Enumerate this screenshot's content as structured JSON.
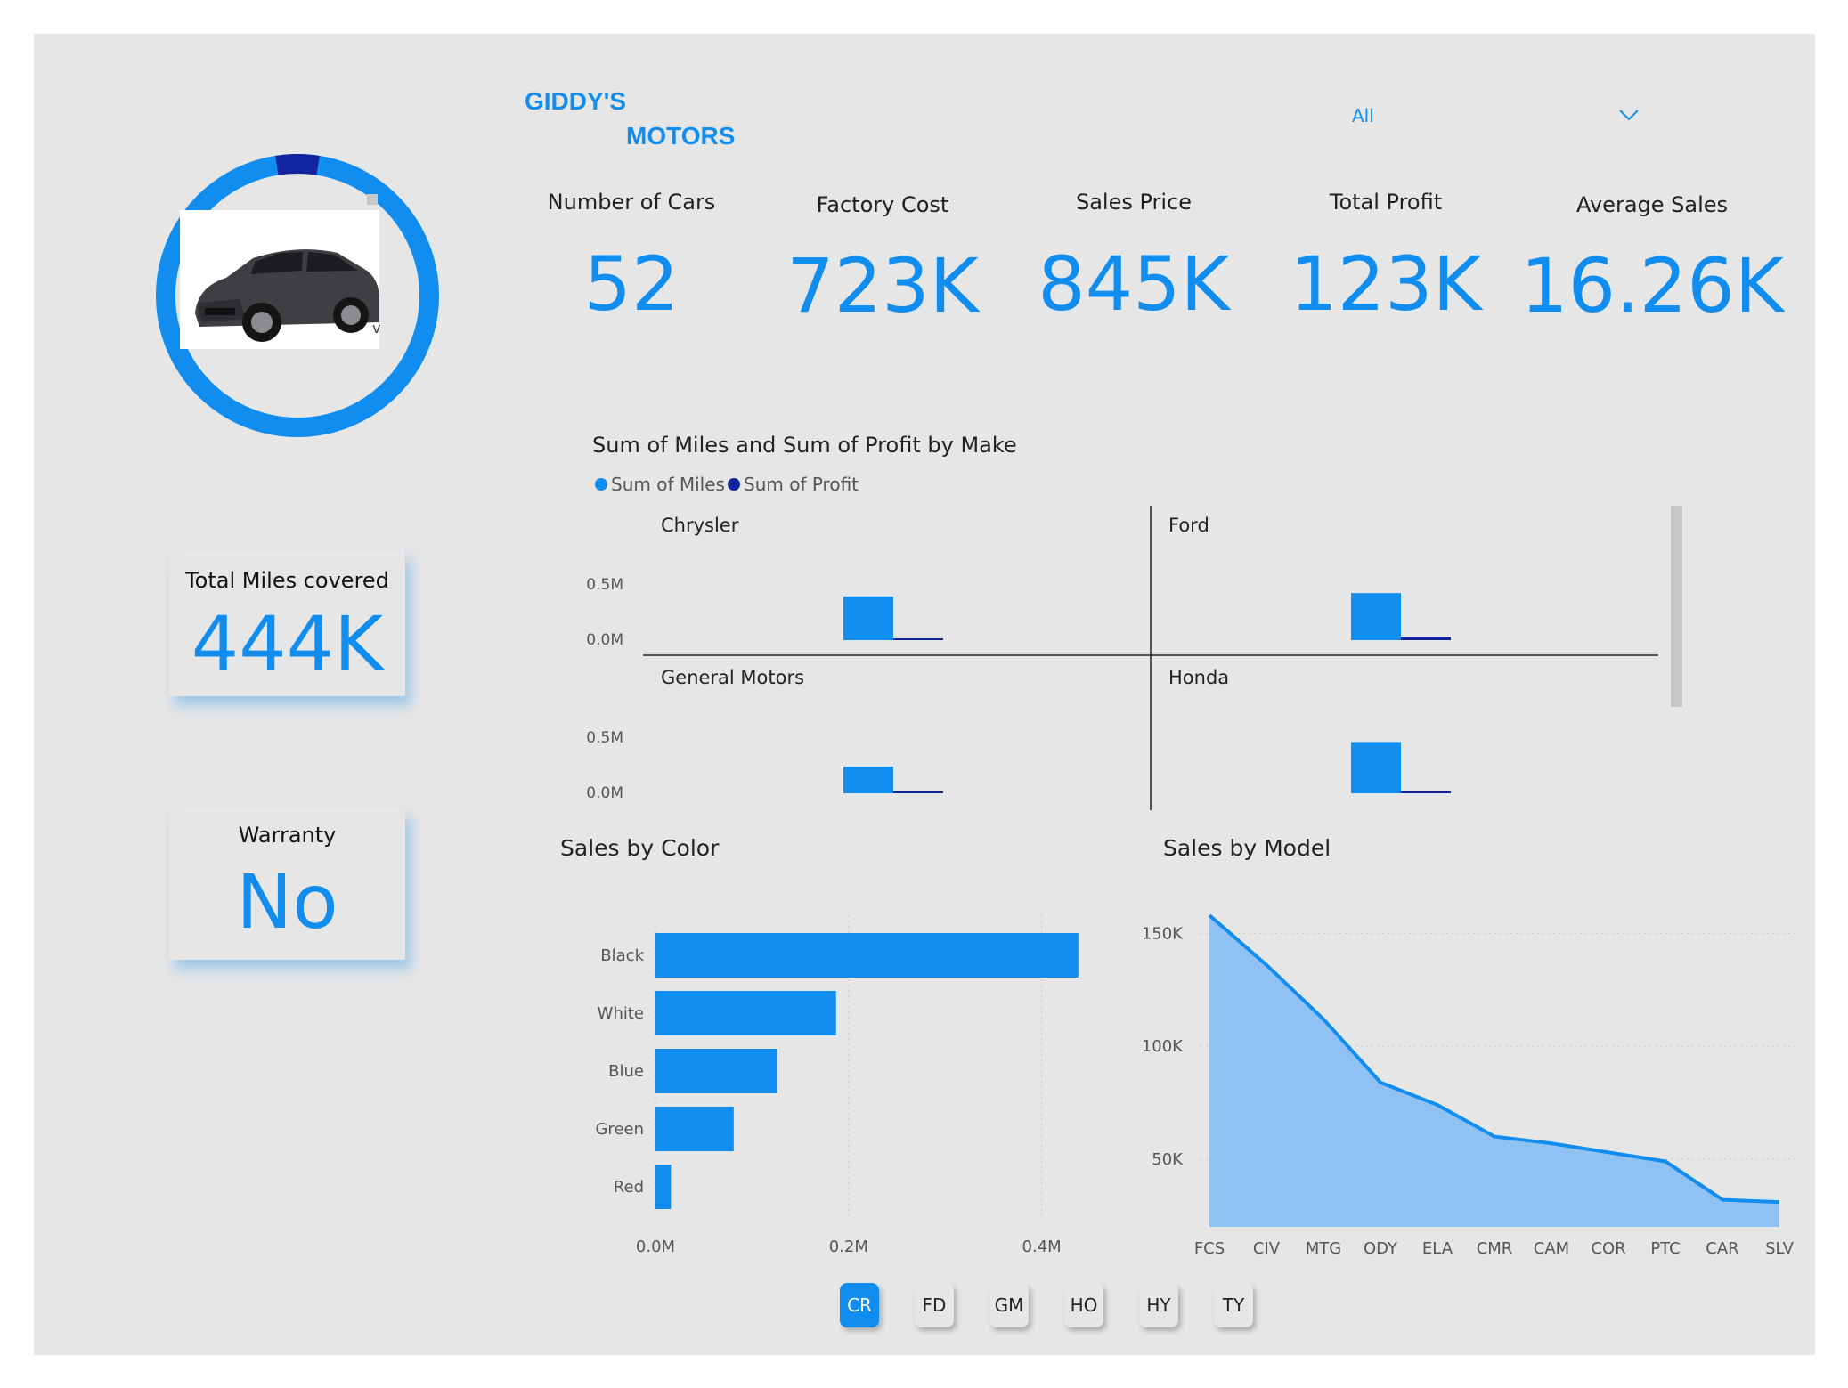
{
  "brand": {
    "line1": "GIDDY'S",
    "line2": "MOTORS"
  },
  "filter": {
    "selected": "All",
    "icon": "chevron-down-icon"
  },
  "kpis": [
    {
      "label": "Number of Cars",
      "value": "52"
    },
    {
      "label": "Factory Cost",
      "value": "723K"
    },
    {
      "label": "Sales Price",
      "value": "845K"
    },
    {
      "label": "Total Profit",
      "value": "123K"
    },
    {
      "label": "Average Sales",
      "value": "16.26K"
    }
  ],
  "cards": {
    "miles": {
      "label": "Total Miles covered",
      "value": "444K"
    },
    "warranty": {
      "label": "Warranty",
      "value": "No"
    }
  },
  "image_panel": {
    "image": "car-image",
    "chevron": "v",
    "ring_fill_fraction": 0.05
  },
  "colors": {
    "accent": "#118df0",
    "dark": "#12239e",
    "area": "#8fc2f2",
    "background": "#e6e6e6"
  },
  "chart_data": [
    {
      "type": "bar",
      "title": "Sum of Miles and Sum of Profit by Make",
      "legend": [
        "Sum of Miles",
        "Sum of Profit"
      ],
      "ytick_labels": [
        "0.5M",
        "0.0M"
      ],
      "ylim": [
        0,
        0.6
      ],
      "panels": [
        {
          "name": "Chrysler",
          "series": [
            {
              "name": "Sum of Miles",
              "value": 0.41
            },
            {
              "name": "Sum of Profit",
              "value": 0.01
            }
          ]
        },
        {
          "name": "Ford",
          "series": [
            {
              "name": "Sum of Miles",
              "value": 0.44
            },
            {
              "name": "Sum of Profit",
              "value": 0.03
            }
          ]
        },
        {
          "name": "General Motors",
          "series": [
            {
              "name": "Sum of Miles",
              "value": 0.25
            },
            {
              "name": "Sum of Profit",
              "value": 0.01
            }
          ]
        },
        {
          "name": "Honda",
          "series": [
            {
              "name": "Sum of Miles",
              "value": 0.48
            },
            {
              "name": "Sum of Profit",
              "value": 0.02
            }
          ]
        }
      ]
    },
    {
      "type": "bar",
      "orientation": "horizontal",
      "title": "Sales by Color",
      "categories": [
        "Black",
        "White",
        "Blue",
        "Green",
        "Red"
      ],
      "values": [
        0.438,
        0.187,
        0.126,
        0.081,
        0.016
      ],
      "xlim": [
        0,
        0.5
      ],
      "xtick_labels": [
        "0.0M",
        "0.2M",
        "0.4M"
      ],
      "xtick_values": [
        0,
        0.2,
        0.4
      ]
    },
    {
      "type": "area",
      "title": "Sales by Model",
      "categories": [
        "FCS",
        "CIV",
        "MTG",
        "ODY",
        "ELA",
        "CMR",
        "CAM",
        "COR",
        "PTC",
        "CAR",
        "SLV"
      ],
      "values": [
        158000,
        136000,
        112000,
        84000,
        74000,
        60000,
        57000,
        53000,
        49000,
        32000,
        31000
      ],
      "ylim": [
        20000,
        160000
      ],
      "ytick_labels": [
        "150K",
        "100K",
        "50K"
      ],
      "ytick_values": [
        150000,
        100000,
        50000
      ]
    }
  ],
  "nav": {
    "buttons": [
      {
        "label": "CR",
        "active": true
      },
      {
        "label": "FD",
        "active": false
      },
      {
        "label": "GM",
        "active": false
      },
      {
        "label": "HO",
        "active": false
      },
      {
        "label": "HY",
        "active": false
      },
      {
        "label": "TY",
        "active": false
      }
    ]
  }
}
